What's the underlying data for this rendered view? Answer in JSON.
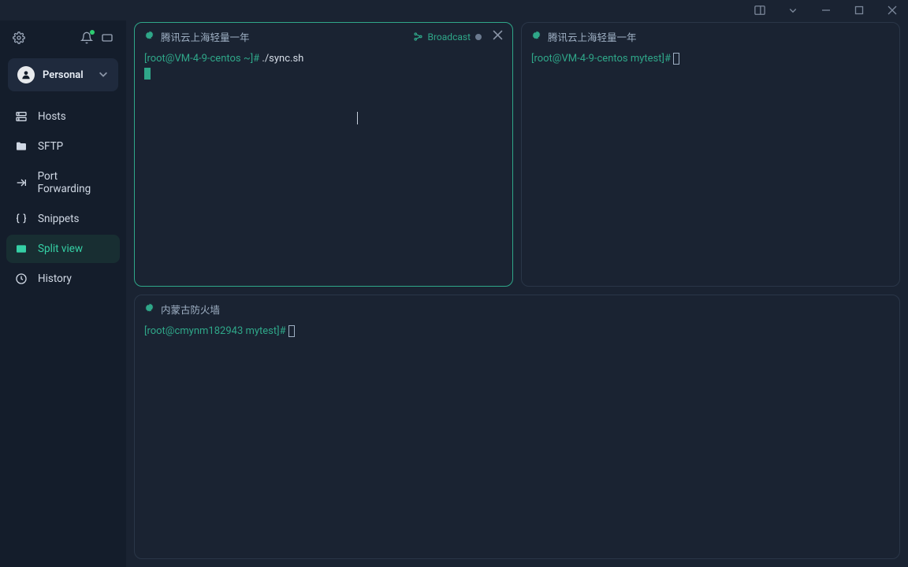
{
  "workspace": {
    "name": "Personal"
  },
  "nav": {
    "hosts": "Hosts",
    "sftp": "SFTP",
    "portfw": "Port Forwarding",
    "snippets": "Snippets",
    "split": "Split view",
    "history": "History"
  },
  "panes": {
    "topLeft": {
      "title": "腾讯云上海轻量一年",
      "broadcast": "Broadcast",
      "prompt": "[root@VM-4-9-centos ~]#",
      "command": "./sync.sh"
    },
    "topRight": {
      "title": "腾讯云上海轻量一年",
      "prompt": "[root@VM-4-9-centos mytest]#"
    },
    "bottom": {
      "title": "内蒙古防火墙",
      "prompt": "[root@cmynm182943 mytest]#"
    }
  }
}
